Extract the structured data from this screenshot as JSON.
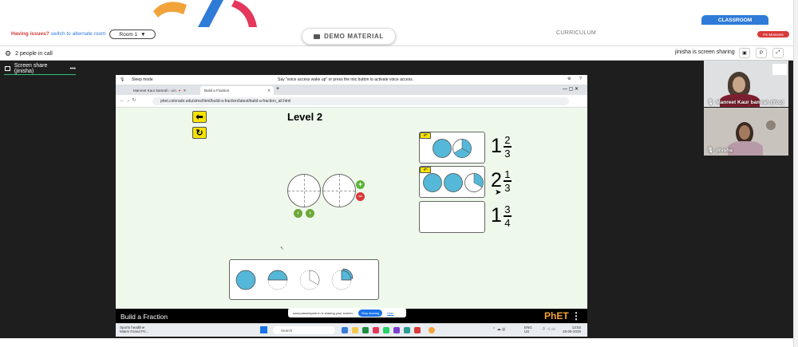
{
  "header": {
    "issue_text": "Having issues?",
    "alt_room_link": "switch to alternate room",
    "room_selector": "Room 1",
    "demo_button": "DEMO MATERIAL",
    "curriculum_tab": "CURRICULUM",
    "classroom_tab": "CLASSROOM",
    "ps_moments_badge": "PS Moments"
  },
  "callbar": {
    "people_count": "2 people in call",
    "sharing_status": "jinisha is screen sharing",
    "p_button": "P"
  },
  "screenshare_tab": "Screen share (jinisha)",
  "remote": {
    "sleep_mode": "Sleep mode",
    "voice_hint": "Say \"voice access wake up\" or press the mic button to activate voice access.",
    "tab1": "Manreet Kaur bamrah - Lin",
    "tab2": "Build a Fraction",
    "url": "phet.colorado.edu/sims/html/build-a-fraction/latest/build-a-fraction_all.html",
    "sim": {
      "level_title": "Level 2",
      "targets": [
        {
          "whole": "1",
          "numerator": "2",
          "denominator": "3"
        },
        {
          "whole": "2",
          "numerator": "1",
          "denominator": "3"
        },
        {
          "whole": "1",
          "numerator": "3",
          "denominator": "4"
        }
      ],
      "bottom_title": "Build a Fraction",
      "phet_logo": "PhET",
      "sharing_notice": "www.planetspark.in is sharing your screen.",
      "stop_sharing": "Stop sharing",
      "hide": "Hide"
    },
    "taskbar": {
      "weather_title": "Sports headline",
      "weather_sub": "Miami Grand Pri...",
      "search": "Search",
      "lang": "ENG",
      "region": "US",
      "time": "13:52",
      "date": "18-05-2025"
    }
  },
  "participants": [
    {
      "name": "Manreet Kaur bamrah (You)"
    },
    {
      "name": "jinisha"
    }
  ],
  "colors": {
    "accent_blue": "#2f7bd8",
    "alert_red": "#d93a3a",
    "piece_blue": "#56b8d8",
    "sim_bg": "#eef9ec",
    "button_yellow": "#f7e300"
  }
}
